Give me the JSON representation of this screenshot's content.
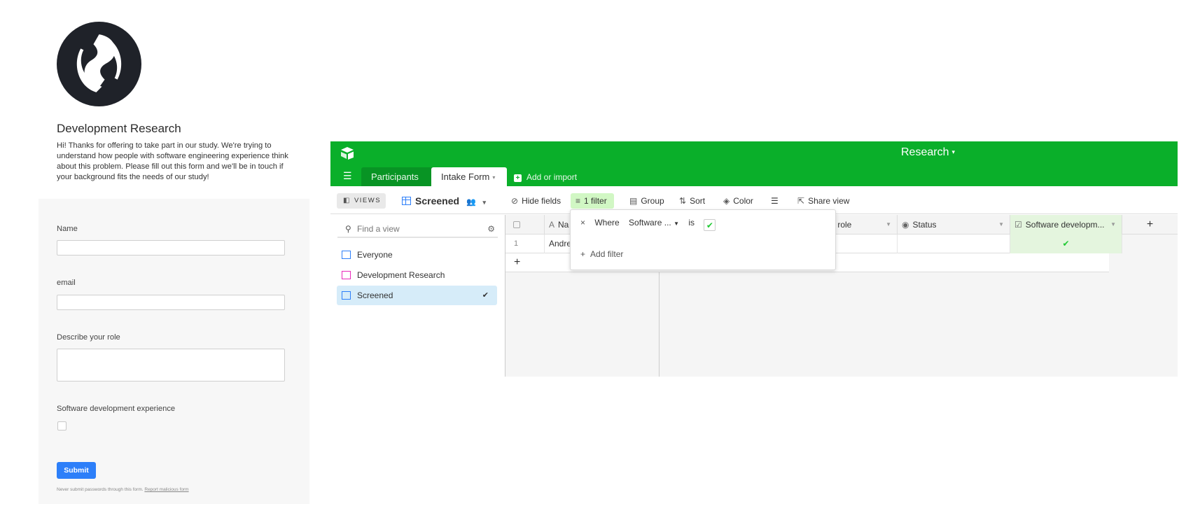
{
  "form": {
    "title": "Development Research",
    "description": "Hi! Thanks for offering to take part in our study. We're trying to understand how people with software engineering experience think about this problem. Please fill out this form and we'll be in touch if your background fits the needs of our study!",
    "fields": {
      "name_label": "Name",
      "name_value": "",
      "email_label": "email",
      "email_value": "",
      "role_label": "Describe your role",
      "role_value": "",
      "experience_label": "Software development experience"
    },
    "submit_label": "Submit",
    "footer_text": "Never submit passwords through this form.",
    "footer_link": "Report malicious form"
  },
  "app": {
    "base_title": "Research",
    "caret": "▾",
    "tabs": [
      {
        "label": "Participants"
      },
      {
        "label": "Intake Form"
      }
    ],
    "add_import": "Add or import",
    "toolbar": {
      "views": "VIEWS",
      "view_name": "Screened",
      "hide_fields": "Hide fields",
      "filter": "1 filter",
      "group": "Group",
      "sort": "Sort",
      "color": "Color",
      "share_view": "Share view"
    },
    "sidebar": {
      "find_placeholder": "Find a view",
      "views": [
        {
          "label": "Everyone",
          "icon": "grid-icon",
          "color": "#2d7ff9"
        },
        {
          "label": "Development Research",
          "icon": "form-icon",
          "color": "#e929ba"
        },
        {
          "label": "Screened",
          "icon": "grid-icon",
          "color": "#2d7ff9"
        }
      ]
    },
    "grid": {
      "columns": [
        "Na",
        "r role",
        "Status",
        "Software developm..."
      ],
      "add_column": "+",
      "rows": [
        {
          "number": "1",
          "name": "Andre",
          "experience": "✔"
        }
      ],
      "add_row": "+"
    },
    "filter_popup": {
      "remove": "×",
      "where": "Where",
      "field": "Software ...",
      "operator": "is",
      "value": "✔",
      "add_filter": "Add filter"
    },
    "colors": {
      "accent_green": "#0aaf2a",
      "filter_bg": "#d1f7c4",
      "selected_bg": "#d6ecf9",
      "submit_blue": "#2d7ff9"
    }
  }
}
